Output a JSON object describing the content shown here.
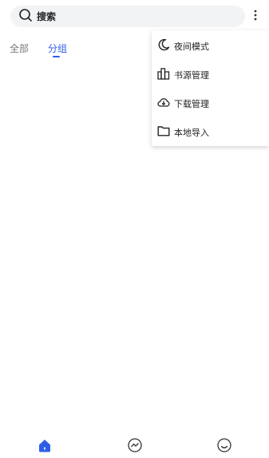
{
  "search": {
    "label": "搜索",
    "icon": "search-icon"
  },
  "toolbar": {
    "more_icon": "more-vertical-icon"
  },
  "tabs": [
    {
      "label": "全部",
      "active": false
    },
    {
      "label": "分组",
      "active": true
    }
  ],
  "menu": {
    "items": [
      {
        "label": "夜间模式",
        "icon": "moon-icon"
      },
      {
        "label": "书源管理",
        "icon": "bookshelf-icon"
      },
      {
        "label": "下载管理",
        "icon": "cloud-download-icon"
      },
      {
        "label": "本地导入",
        "icon": "folder-icon"
      }
    ]
  },
  "bottom_nav": {
    "items": [
      {
        "icon": "home-icon",
        "active": true
      },
      {
        "icon": "discover-icon",
        "active": false
      },
      {
        "icon": "profile-icon",
        "active": false
      }
    ]
  },
  "colors": {
    "accent": "#2f5de6",
    "search_bg": "#f1f3f4"
  }
}
